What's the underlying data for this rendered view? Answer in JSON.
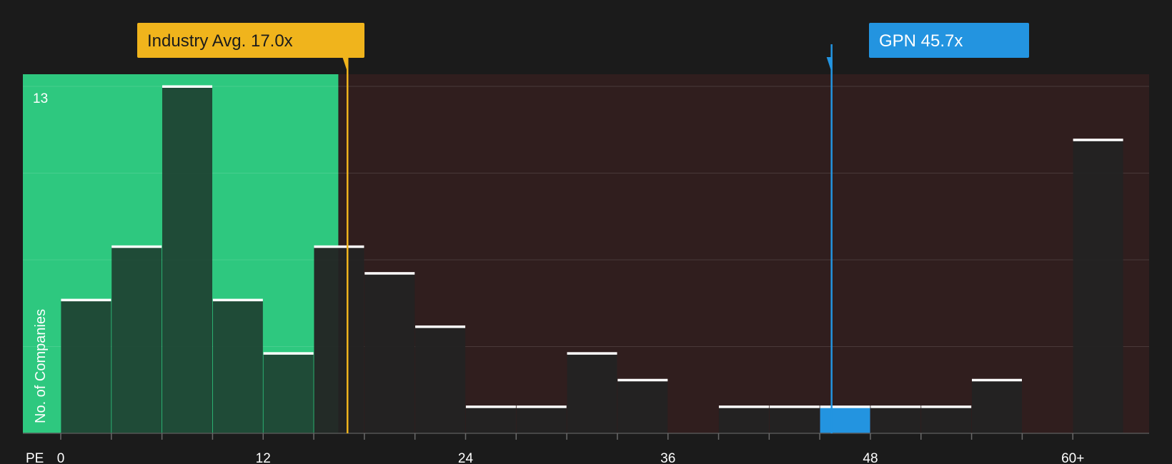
{
  "chart_data": {
    "type": "bar",
    "xlabel": "PE",
    "ylabel": "No. of Companies",
    "y_tick_label": "13",
    "ylim": [
      0,
      13
    ],
    "x_ticks": [
      "0",
      "12",
      "24",
      "36",
      "48",
      "60+"
    ],
    "bins": [
      {
        "x": 1.5,
        "value": 5
      },
      {
        "x": 4.5,
        "value": 7
      },
      {
        "x": 7.5,
        "value": 13
      },
      {
        "x": 10.5,
        "value": 5
      },
      {
        "x": 13.5,
        "value": 3
      },
      {
        "x": 16.5,
        "value": 7
      },
      {
        "x": 19.5,
        "value": 6
      },
      {
        "x": 22.5,
        "value": 4
      },
      {
        "x": 25.5,
        "value": 1
      },
      {
        "x": 28.5,
        "value": 1
      },
      {
        "x": 31.5,
        "value": 3
      },
      {
        "x": 34.5,
        "value": 2
      },
      {
        "x": 37.5,
        "value": 0
      },
      {
        "x": 40.5,
        "value": 1
      },
      {
        "x": 43.5,
        "value": 1
      },
      {
        "x": 46.5,
        "value": 1,
        "highlight": true
      },
      {
        "x": 49.5,
        "value": 1
      },
      {
        "x": 52.5,
        "value": 1
      },
      {
        "x": 55.5,
        "value": 2
      },
      {
        "x": 58.5,
        "value": 0
      },
      {
        "x": 61.5,
        "value": 11
      }
    ],
    "industry_avg": {
      "label": "Industry Avg. 17.0x",
      "value": 17.0
    },
    "company": {
      "label": "GPN 45.7x",
      "value": 45.7
    },
    "colors": {
      "background": "#1b1b1b",
      "good_zone": "#2ec87f",
      "bad_zone": "#301e1e",
      "bar": "#232323",
      "bar_in_good_zone": "#1f4434",
      "highlight_bar": "#2394e0",
      "cap": "#ffffff",
      "industry": "#f0b41c",
      "company": "#2394e0",
      "grid": "#ffffff"
    }
  }
}
